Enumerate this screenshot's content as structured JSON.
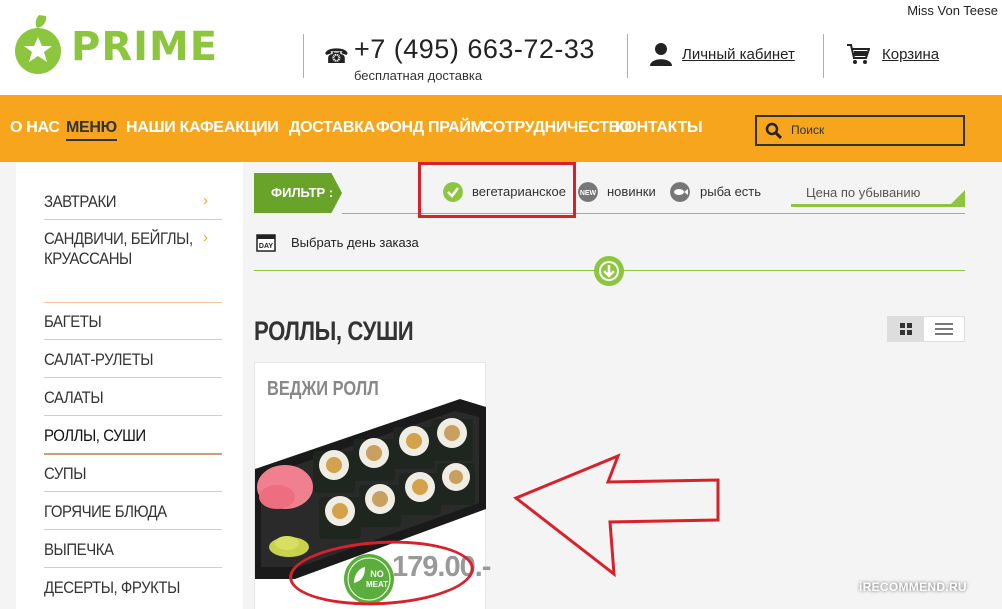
{
  "watermark_user": "Miss Von Teese",
  "brand": {
    "name": "PRIME",
    "color": "#8cc63f"
  },
  "header": {
    "phone": "+7 (495) 663-72-33",
    "phone_sub": "бесплатная доставка",
    "cabinet": "Личный кабинет",
    "cart": "Корзина"
  },
  "nav": {
    "items": [
      "О НАС",
      "МЕНЮ",
      "НАШИ КАФЕ",
      "АКЦИИ",
      "ДОСТАВКА",
      "ФОНД ПРАЙМ",
      "СОТРУДНИЧЕСТВО",
      "КОНТАКТЫ"
    ],
    "active": "МЕНЮ",
    "search_placeholder": "Поиск",
    "bg_color": "#f7a51c"
  },
  "sidebar": {
    "items": [
      "ЗАВТРАКИ",
      "САНДВИЧИ, БЕЙГЛЫ, КРУАССАНЫ",
      "БАГЕТЫ",
      "САЛАТ-РУЛЕТЫ",
      "САЛАТЫ",
      "РОЛЛЫ, СУШИ",
      "СУПЫ",
      "ГОРЯЧИЕ БЛЮДА",
      "ВЫПЕЧКА",
      "ДЕСЕРТЫ, ФРУКТЫ"
    ],
    "active": "РОЛЛЫ, СУШИ"
  },
  "filter": {
    "label": "ФИЛЬТР :",
    "options": [
      {
        "label": "вегетарианское",
        "icon": "vegetarian-icon"
      },
      {
        "label": "новинки",
        "icon": "new-icon"
      },
      {
        "label": "рыба есть",
        "icon": "fish-icon"
      }
    ],
    "sort": "Цена по убыванию"
  },
  "day_select": "Выбрать день заказа",
  "day_icon_text": "DAY",
  "section_title": "РОЛЛЫ, СУШИ",
  "products": [
    {
      "title": "ВЕДЖИ РОЛЛ",
      "price": "179.00.-",
      "badge_line1": "NO",
      "badge_line2": "MEAT"
    }
  ],
  "site_watermark": "iRECOMMEND.RU",
  "annotation_color": "#d8212b"
}
